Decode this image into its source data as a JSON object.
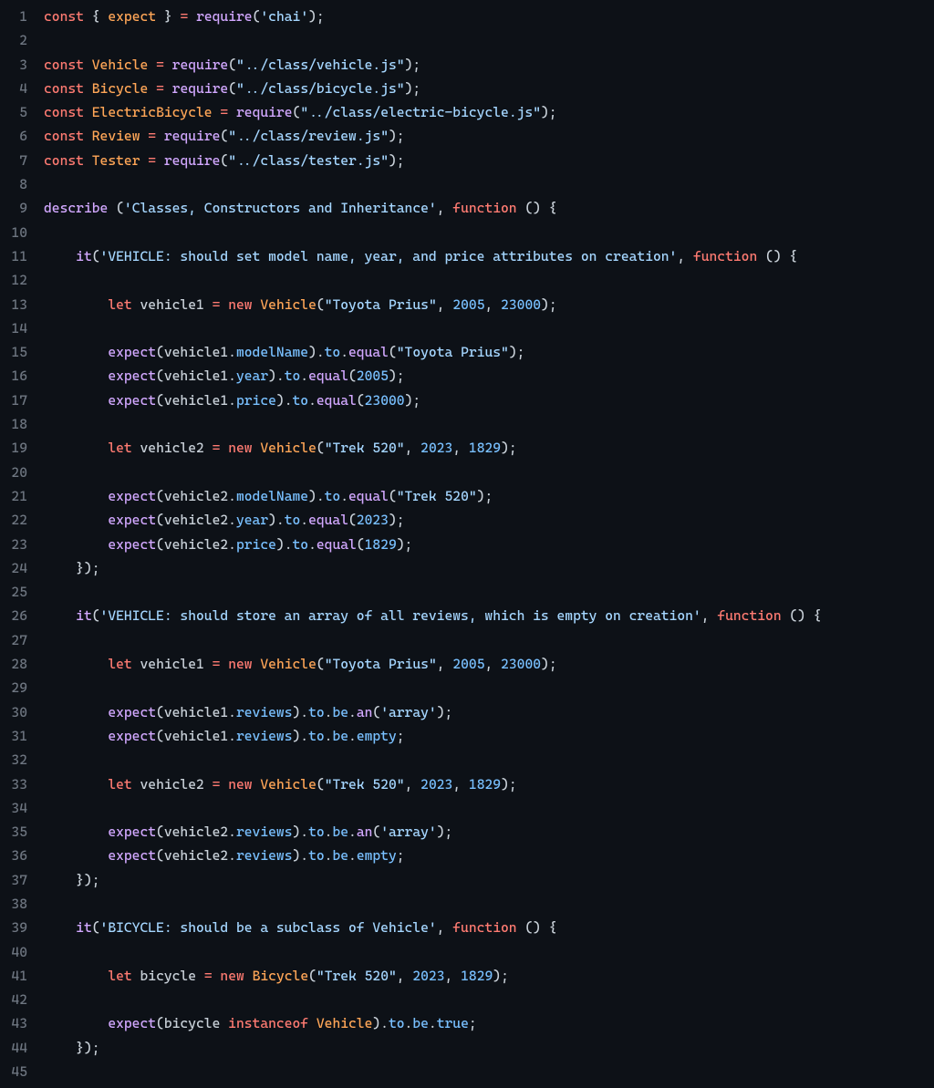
{
  "lines": [
    {
      "n": 1,
      "h": "<span class='k'>const</span> <span class='p'>{</span> <span class='cls'>expect</span> <span class='p'>}</span> <span class='op'>=</span> <span class='fn'>require</span><span class='p'>(</span><span class='str'>'chai'</span><span class='p'>);</span>"
    },
    {
      "n": 2,
      "h": ""
    },
    {
      "n": 3,
      "h": "<span class='k'>const</span> <span class='cls'>Vehicle</span> <span class='op'>=</span> <span class='fn'>require</span><span class='p'>(</span><span class='str'>\"../class/vehicle.js\"</span><span class='p'>);</span>"
    },
    {
      "n": 4,
      "h": "<span class='k'>const</span> <span class='cls'>Bicycle</span> <span class='op'>=</span> <span class='fn'>require</span><span class='p'>(</span><span class='str'>\"../class/bicycle.js\"</span><span class='p'>);</span>"
    },
    {
      "n": 5,
      "h": "<span class='k'>const</span> <span class='cls'>ElectricBicycle</span> <span class='op'>=</span> <span class='fn'>require</span><span class='p'>(</span><span class='str'>\"../class/electric-bicycle.js\"</span><span class='p'>);</span>"
    },
    {
      "n": 6,
      "h": "<span class='k'>const</span> <span class='cls'>Review</span> <span class='op'>=</span> <span class='fn'>require</span><span class='p'>(</span><span class='str'>\"../class/review.js\"</span><span class='p'>);</span>"
    },
    {
      "n": 7,
      "h": "<span class='k'>const</span> <span class='cls'>Tester</span> <span class='op'>=</span> <span class='fn'>require</span><span class='p'>(</span><span class='str'>\"../class/tester.js\"</span><span class='p'>);</span>"
    },
    {
      "n": 8,
      "h": ""
    },
    {
      "n": 9,
      "h": "<span class='fn'>describe</span> <span class='p'>(</span><span class='str'>'Classes, Constructors and Inheritance'</span><span class='p'>,</span> <span class='k'>function</span> <span class='p'>()</span> <span class='p'>{</span>"
    },
    {
      "n": 10,
      "h": ""
    },
    {
      "n": 11,
      "h": "    <span class='fn'>it</span><span class='p'>(</span><span class='str'>'VEHICLE: should set model name, year, and price attributes on creation'</span><span class='p'>,</span> <span class='k'>function</span> <span class='p'>()</span> <span class='p'>{</span>"
    },
    {
      "n": 12,
      "h": ""
    },
    {
      "n": 13,
      "h": "        <span class='k'>let</span> <span class='var'>vehicle1</span> <span class='op'>=</span> <span class='k'>new</span> <span class='cls'>Vehicle</span><span class='p'>(</span><span class='str'>\"Toyota Prius\"</span><span class='p'>,</span> <span class='num'>2005</span><span class='p'>,</span> <span class='num'>23000</span><span class='p'>);</span>"
    },
    {
      "n": 14,
      "h": ""
    },
    {
      "n": 15,
      "h": "        <span class='fn'>expect</span><span class='p'>(</span><span class='var'>vehicle1</span><span class='p'>.</span><span class='prop'>modelName</span><span class='p'>).</span><span class='prop'>to</span><span class='p'>.</span><span class='fn'>equal</span><span class='p'>(</span><span class='str'>\"Toyota Prius\"</span><span class='p'>);</span>"
    },
    {
      "n": 16,
      "h": "        <span class='fn'>expect</span><span class='p'>(</span><span class='var'>vehicle1</span><span class='p'>.</span><span class='prop'>year</span><span class='p'>).</span><span class='prop'>to</span><span class='p'>.</span><span class='fn'>equal</span><span class='p'>(</span><span class='num'>2005</span><span class='p'>);</span>"
    },
    {
      "n": 17,
      "h": "        <span class='fn'>expect</span><span class='p'>(</span><span class='var'>vehicle1</span><span class='p'>.</span><span class='prop'>price</span><span class='p'>).</span><span class='prop'>to</span><span class='p'>.</span><span class='fn'>equal</span><span class='p'>(</span><span class='num'>23000</span><span class='p'>);</span>"
    },
    {
      "n": 18,
      "h": ""
    },
    {
      "n": 19,
      "h": "        <span class='k'>let</span> <span class='var'>vehicle2</span> <span class='op'>=</span> <span class='k'>new</span> <span class='cls'>Vehicle</span><span class='p'>(</span><span class='str'>\"Trek 520\"</span><span class='p'>,</span> <span class='num'>2023</span><span class='p'>,</span> <span class='num'>1829</span><span class='p'>);</span>"
    },
    {
      "n": 20,
      "h": ""
    },
    {
      "n": 21,
      "h": "        <span class='fn'>expect</span><span class='p'>(</span><span class='var'>vehicle2</span><span class='p'>.</span><span class='prop'>modelName</span><span class='p'>).</span><span class='prop'>to</span><span class='p'>.</span><span class='fn'>equal</span><span class='p'>(</span><span class='str'>\"Trek 520\"</span><span class='p'>);</span>"
    },
    {
      "n": 22,
      "h": "        <span class='fn'>expect</span><span class='p'>(</span><span class='var'>vehicle2</span><span class='p'>.</span><span class='prop'>year</span><span class='p'>).</span><span class='prop'>to</span><span class='p'>.</span><span class='fn'>equal</span><span class='p'>(</span><span class='num'>2023</span><span class='p'>);</span>"
    },
    {
      "n": 23,
      "h": "        <span class='fn'>expect</span><span class='p'>(</span><span class='var'>vehicle2</span><span class='p'>.</span><span class='prop'>price</span><span class='p'>).</span><span class='prop'>to</span><span class='p'>.</span><span class='fn'>equal</span><span class='p'>(</span><span class='num'>1829</span><span class='p'>);</span>"
    },
    {
      "n": 24,
      "h": "    <span class='p'>});</span>"
    },
    {
      "n": 25,
      "h": ""
    },
    {
      "n": 26,
      "h": "    <span class='fn'>it</span><span class='p'>(</span><span class='str'>'VEHICLE: should store an array of all reviews, which is empty on creation'</span><span class='p'>,</span> <span class='k'>function</span> <span class='p'>()</span> <span class='p'>{</span>"
    },
    {
      "n": 27,
      "h": ""
    },
    {
      "n": 28,
      "h": "        <span class='k'>let</span> <span class='var'>vehicle1</span> <span class='op'>=</span> <span class='k'>new</span> <span class='cls'>Vehicle</span><span class='p'>(</span><span class='str'>\"Toyota Prius\"</span><span class='p'>,</span> <span class='num'>2005</span><span class='p'>,</span> <span class='num'>23000</span><span class='p'>);</span>"
    },
    {
      "n": 29,
      "h": ""
    },
    {
      "n": 30,
      "h": "        <span class='fn'>expect</span><span class='p'>(</span><span class='var'>vehicle1</span><span class='p'>.</span><span class='prop'>reviews</span><span class='p'>).</span><span class='prop'>to</span><span class='p'>.</span><span class='prop'>be</span><span class='p'>.</span><span class='fn'>an</span><span class='p'>(</span><span class='str'>'array'</span><span class='p'>);</span>"
    },
    {
      "n": 31,
      "h": "        <span class='fn'>expect</span><span class='p'>(</span><span class='var'>vehicle1</span><span class='p'>.</span><span class='prop'>reviews</span><span class='p'>).</span><span class='prop'>to</span><span class='p'>.</span><span class='prop'>be</span><span class='p'>.</span><span class='prop'>empty</span><span class='p'>;</span>"
    },
    {
      "n": 32,
      "h": ""
    },
    {
      "n": 33,
      "h": "        <span class='k'>let</span> <span class='var'>vehicle2</span> <span class='op'>=</span> <span class='k'>new</span> <span class='cls'>Vehicle</span><span class='p'>(</span><span class='str'>\"Trek 520\"</span><span class='p'>,</span> <span class='num'>2023</span><span class='p'>,</span> <span class='num'>1829</span><span class='p'>);</span>"
    },
    {
      "n": 34,
      "h": ""
    },
    {
      "n": 35,
      "h": "        <span class='fn'>expect</span><span class='p'>(</span><span class='var'>vehicle2</span><span class='p'>.</span><span class='prop'>reviews</span><span class='p'>).</span><span class='prop'>to</span><span class='p'>.</span><span class='prop'>be</span><span class='p'>.</span><span class='fn'>an</span><span class='p'>(</span><span class='str'>'array'</span><span class='p'>);</span>"
    },
    {
      "n": 36,
      "h": "        <span class='fn'>expect</span><span class='p'>(</span><span class='var'>vehicle2</span><span class='p'>.</span><span class='prop'>reviews</span><span class='p'>).</span><span class='prop'>to</span><span class='p'>.</span><span class='prop'>be</span><span class='p'>.</span><span class='prop'>empty</span><span class='p'>;</span>"
    },
    {
      "n": 37,
      "h": "    <span class='p'>});</span>"
    },
    {
      "n": 38,
      "h": ""
    },
    {
      "n": 39,
      "h": "    <span class='fn'>it</span><span class='p'>(</span><span class='str'>'BICYCLE: should be a subclass of Vehicle'</span><span class='p'>,</span> <span class='k'>function</span> <span class='p'>()</span> <span class='p'>{</span>"
    },
    {
      "n": 40,
      "h": ""
    },
    {
      "n": 41,
      "h": "        <span class='k'>let</span> <span class='var'>bicycle</span> <span class='op'>=</span> <span class='k'>new</span> <span class='cls'>Bicycle</span><span class='p'>(</span><span class='str'>\"Trek 520\"</span><span class='p'>,</span> <span class='num'>2023</span><span class='p'>,</span> <span class='num'>1829</span><span class='p'>);</span>"
    },
    {
      "n": 42,
      "h": ""
    },
    {
      "n": 43,
      "h": "        <span class='fn'>expect</span><span class='p'>(</span><span class='var'>bicycle</span> <span class='k'>instanceof</span> <span class='cls'>Vehicle</span><span class='p'>).</span><span class='prop'>to</span><span class='p'>.</span><span class='prop'>be</span><span class='p'>.</span><span class='prop'>true</span><span class='p'>;</span>"
    },
    {
      "n": 44,
      "h": "    <span class='p'>});</span>"
    },
    {
      "n": 45,
      "h": ""
    }
  ]
}
